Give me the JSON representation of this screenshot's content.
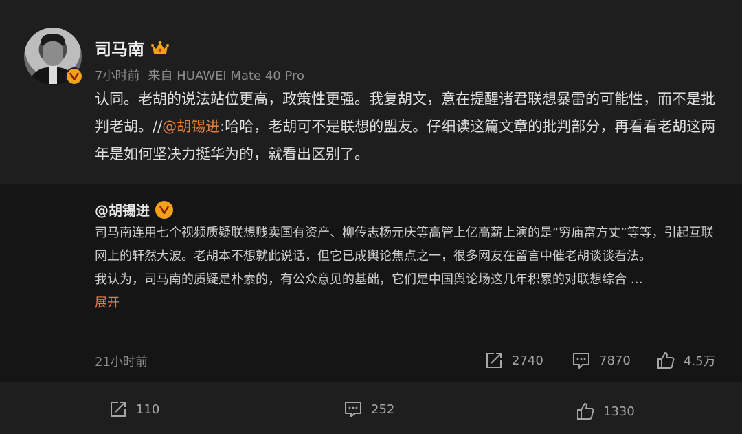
{
  "post": {
    "username": "司马南",
    "crown_icon": "crown-icon",
    "time": "7小时前",
    "source": "来自 HUAWEI Mate 40 Pro",
    "text_part1": "认同。老胡的说法站位更高，政策性更强。我复胡文，意在提醒诸君联想暴雷的可能性，而不是批判老胡。//",
    "mention": "@胡锡进",
    "text_part2": ":哈哈，老胡可不是联想的盟友。仔细读这篇文章的批判部分，再看看老胡这两年是如何坚决力挺华为的，就看出区别了。"
  },
  "repost": {
    "username": "@胡锡进",
    "para1": "司马南连用七个视频质疑联想贱卖国有资产、柳传志杨元庆等高管上亿高薪上演的是“穷庙富方丈”等等，引起互联网上的轩然大波。老胡本不想就此说话，但它已成舆论焦点之一，很多网友在留言中催老胡谈谈看法。",
    "para2": "我认为，司马南的质疑是朴素的，有公众意见的基础，它们是中国舆论场这几年积累的对联想综合 …",
    "expand": "展开",
    "time": "21小时前",
    "shares": "2740",
    "comments": "7870",
    "likes": "4.5万"
  },
  "bottom": {
    "shares": "110",
    "comments": "252",
    "likes": "1330"
  },
  "colors": {
    "accent": "#e8803b",
    "badge": "#f1a21a",
    "background": "#1e1e1e",
    "repost_background": "#151515"
  }
}
